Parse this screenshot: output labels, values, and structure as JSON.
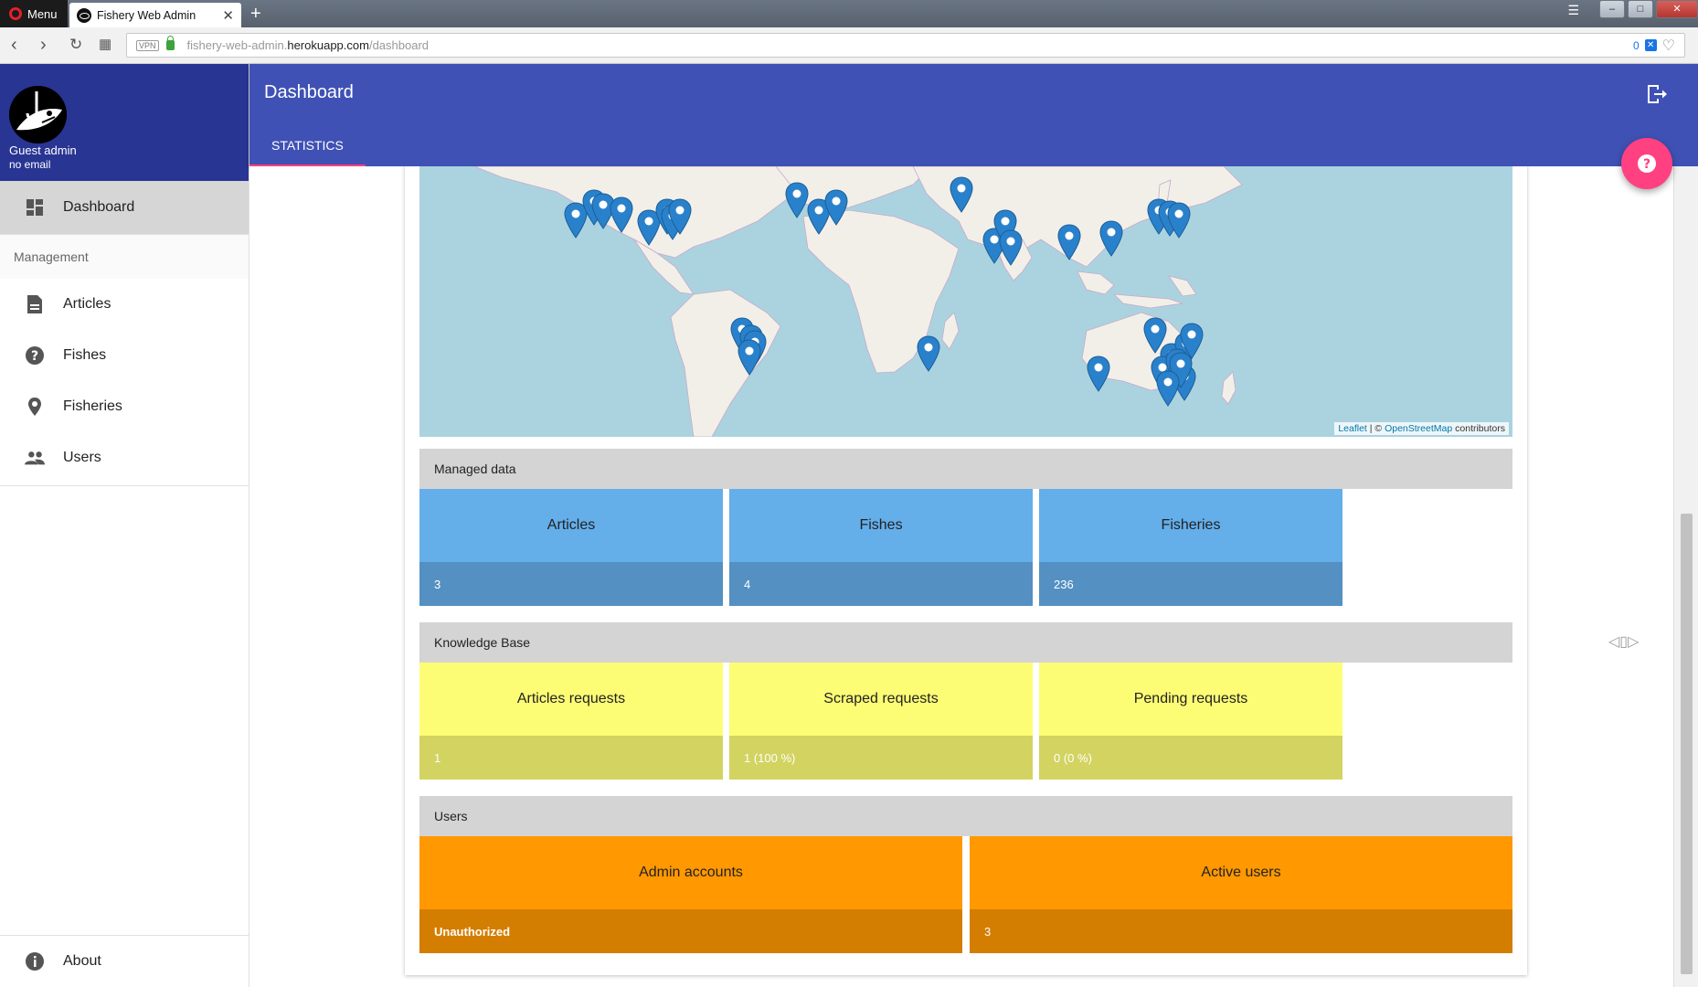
{
  "browser": {
    "menu_label": "Menu",
    "tab_title": "Fishery Web Admin",
    "url_host_prefix": "fishery-web-admin.",
    "url_host": "herokuapp.com",
    "url_path": "/dashboard",
    "vpn_label": "VPN",
    "tracker_count": "0"
  },
  "sidebar": {
    "user_name": "Guest admin",
    "user_email": "no email",
    "items": [
      {
        "label": "Dashboard",
        "icon": "dashboard-icon"
      },
      {
        "label": "Articles",
        "icon": "article-icon"
      },
      {
        "label": "Fishes",
        "icon": "help-circle-icon"
      },
      {
        "label": "Fisheries",
        "icon": "location-pin-icon"
      },
      {
        "label": "Users",
        "icon": "people-icon"
      }
    ],
    "section_label": "Management",
    "about_label": "About"
  },
  "appbar": {
    "title": "Dashboard",
    "tab": "STATISTICS"
  },
  "map": {
    "attribution_leaflet": "Leaflet",
    "attribution_sep": " | © ",
    "attribution_osm": "OpenStreetMap",
    "attribution_tail": " contributors"
  },
  "managed": {
    "header": "Managed data",
    "tiles": [
      {
        "label": "Articles",
        "value": "3"
      },
      {
        "label": "Fishes",
        "value": "4"
      },
      {
        "label": "Fisheries",
        "value": "236"
      }
    ]
  },
  "knowledge": {
    "header": "Knowledge Base",
    "tiles": [
      {
        "label": "Articles requests",
        "value": "1"
      },
      {
        "label": "Scraped requests",
        "value": "1 (100 %)"
      },
      {
        "label": "Pending requests",
        "value": "0 (0 %)"
      }
    ]
  },
  "users": {
    "header": "Users",
    "tiles": [
      {
        "label": "Admin accounts",
        "value": "Unauthorized"
      },
      {
        "label": "Active users",
        "value": "3"
      }
    ]
  },
  "colors": {
    "primary": "#3f51b5",
    "primary_dark": "#283593",
    "accent": "#ff4081",
    "managed": "#64aeea",
    "knowledge": "#fdfd75",
    "users": "#ff9801"
  }
}
